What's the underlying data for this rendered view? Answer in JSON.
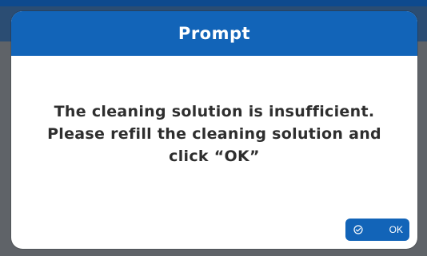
{
  "dialog": {
    "title": "Prompt",
    "message_lines": [
      "The cleaning solution is insufficient.",
      "Please refill the cleaning solution and",
      "click “OK”"
    ],
    "ok_button": {
      "label": "OK",
      "icon": "check-circle-icon"
    }
  },
  "colors": {
    "accent": "#1264b8",
    "overlay": "#5f6368",
    "text": "#2e2e2e"
  }
}
